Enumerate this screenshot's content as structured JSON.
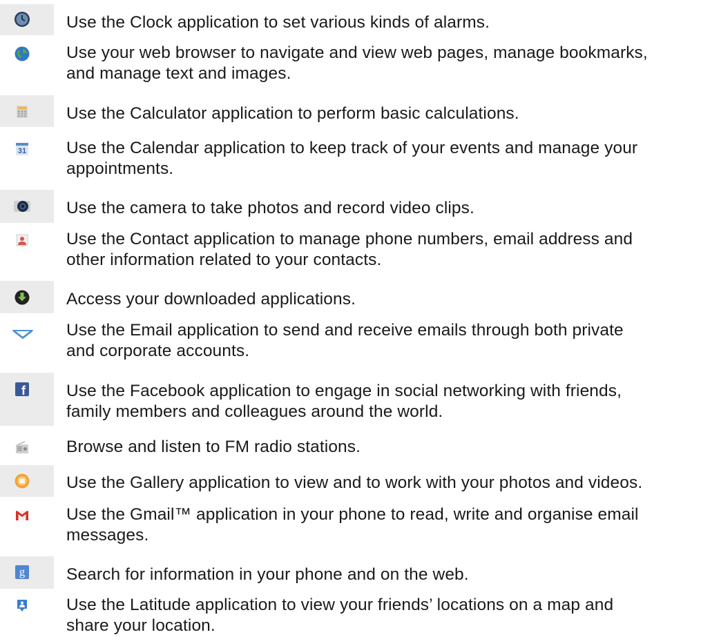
{
  "apps": [
    {
      "icon": "clock-icon",
      "text": "Use the Clock application to set various kinds of alarms."
    },
    {
      "icon": "browser-globe-icon",
      "lines": [
        "Use your web browser to navigate and view web pages, manage bookmarks,",
        "and manage text and images."
      ]
    },
    {
      "icon": "calculator-icon",
      "text": "Use the Calculator application to perform basic calculations."
    },
    {
      "icon": "calendar-icon",
      "calendar_day": "31",
      "lines": [
        "Use the Calendar application to keep track of your events and manage your",
        "appointments."
      ]
    },
    {
      "icon": "camera-icon",
      "text": "Use the camera to take photos and record video clips."
    },
    {
      "icon": "contacts-icon",
      "lines": [
        "Use the Contact application to manage phone numbers, email address and",
        "other information related to your contacts."
      ]
    },
    {
      "icon": "downloads-icon",
      "text": "Access your downloaded applications."
    },
    {
      "icon": "email-envelope-icon",
      "lines": [
        "Use the Email application to send and receive emails through both private",
        "and corporate accounts."
      ]
    },
    {
      "icon": "facebook-icon",
      "icon_letter": "f",
      "lines": [
        "Use the Facebook application to engage in social networking with friends,",
        "family members and colleagues around the world."
      ]
    },
    {
      "icon": "fm-radio-icon",
      "text": "Browse and listen to FM radio stations."
    },
    {
      "icon": "gallery-icon",
      "text": "Use the Gallery application to view and to work with your photos and videos."
    },
    {
      "icon": "gmail-icon",
      "lines": [
        "Use the Gmail™ application in your phone to read, write and organise email",
        "messages."
      ]
    },
    {
      "icon": "google-search-icon",
      "icon_letter": "g",
      "text": "Search for information in your phone and on the web."
    },
    {
      "icon": "latitude-icon",
      "lines": [
        "Use the Latitude application to view your friends’ locations on a map and",
        "share your location."
      ]
    }
  ]
}
